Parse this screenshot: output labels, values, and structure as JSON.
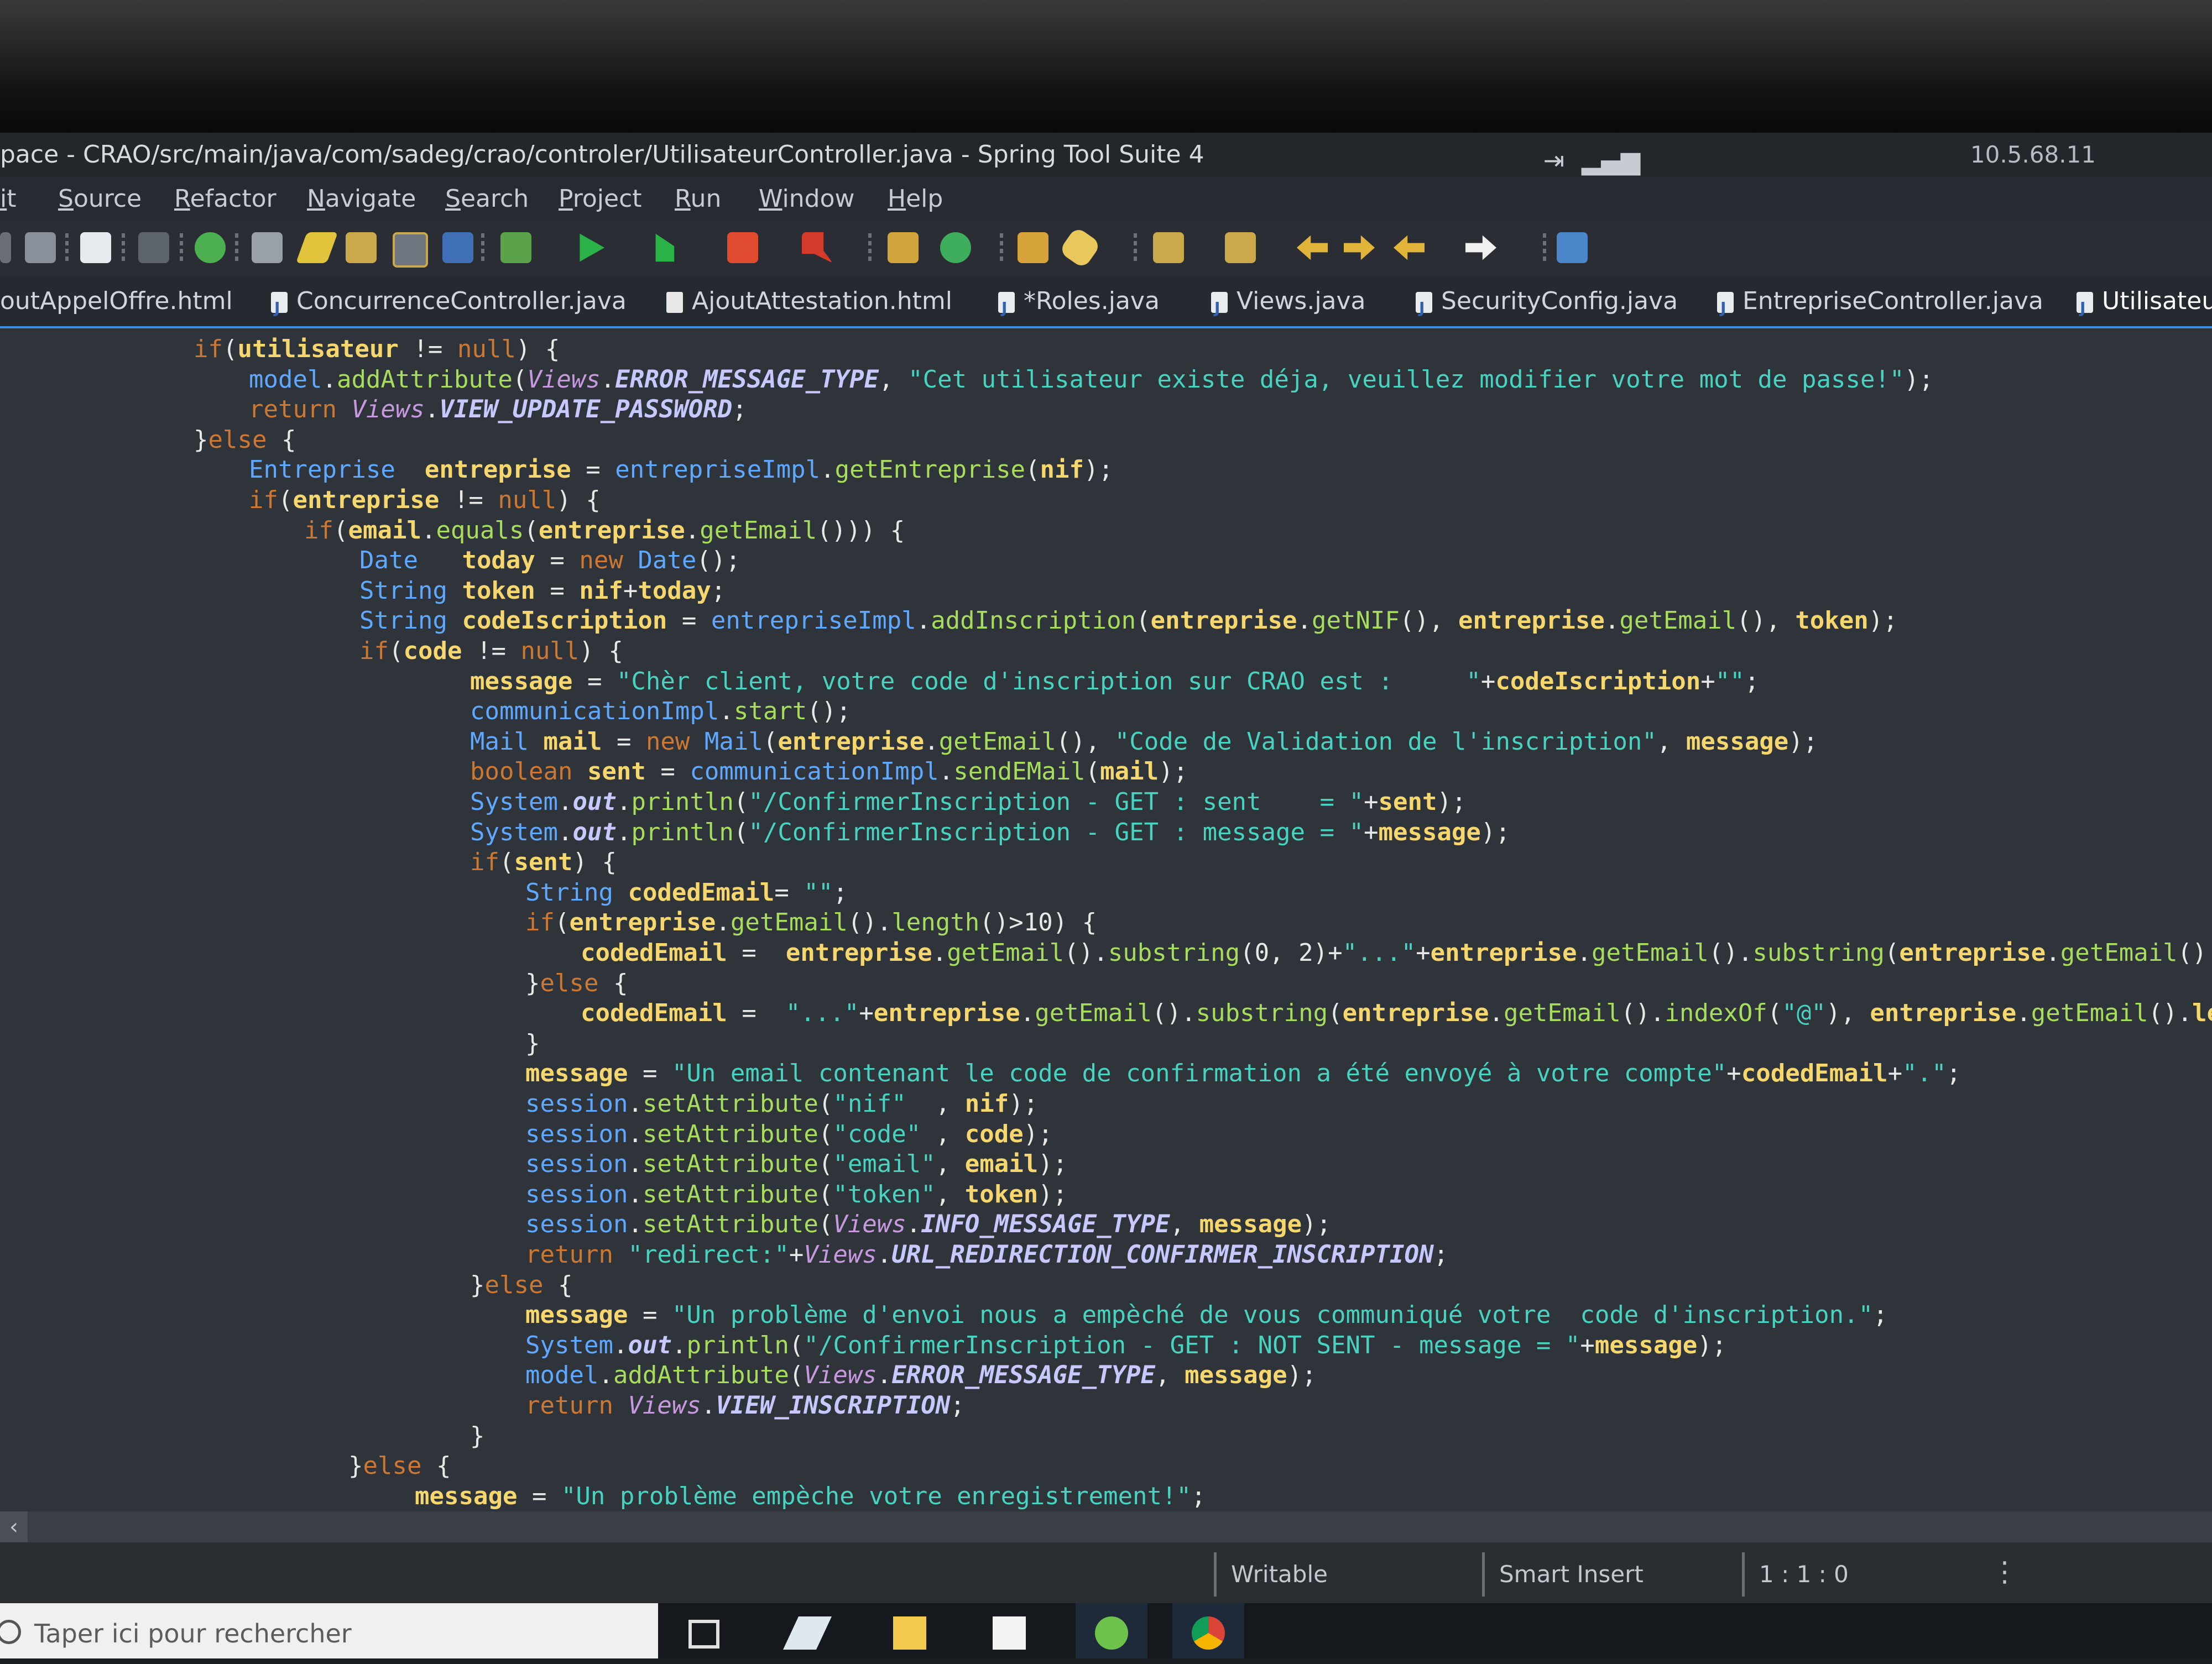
{
  "window": {
    "title": "pace - CRAO/src/main/java/com/sadeg/crao/controler/UtilisateurController.java - Spring Tool Suite 4",
    "ip": "10.5.68.11"
  },
  "menu": [
    "it",
    "Source",
    "Refactor",
    "Navigate",
    "Search",
    "Project",
    "Run",
    "Window",
    "Help"
  ],
  "tabs": [
    {
      "label": "outAppelOffre.html",
      "icon": "html-file-icon"
    },
    {
      "label": "ConcurrenceController.java",
      "icon": "java-file-icon"
    },
    {
      "label": "AjoutAttestation.html",
      "icon": "html-file-icon"
    },
    {
      "label": "*Roles.java",
      "icon": "java-file-icon"
    },
    {
      "label": "Views.java",
      "icon": "java-file-icon"
    },
    {
      "label": "SecurityConfig.java",
      "icon": "java-file-icon"
    },
    {
      "label": "EntrepriseController.java",
      "icon": "java-file-icon"
    },
    {
      "label": "Utilisateu",
      "icon": "java-file-icon",
      "active": true
    }
  ],
  "code_lines": [
    "if(utilisateur != null) {",
    "model.addAttribute(Views.ERROR_MESSAGE_TYPE, \"Cet utilisateur existe déja, veuillez modifier votre mot de passe!\");",
    "return Views.VIEW_UPDATE_PASSWORD;",
    "}else {",
    "Entreprise  entreprise = entrepriseImpl.getEntreprise(nif);",
    "if(entreprise != null) {",
    "if(email.equals(entreprise.getEmail())) {",
    "Date   today = new Date();",
    "String token = nif+today;",
    "String codeIscription = entrepriseImpl.addInscription(entreprise.getNIF(), entreprise.getEmail(), token);",
    "if(code != null) {",
    "message = \"Chèr client, votre code d'inscription sur CRAO est :     \"+codeIscription+\"\";",
    "communicationImpl.start();",
    "Mail mail = new Mail(entreprise.getEmail(), \"Code de Validation de l'inscription\", message);",
    "boolean sent = communicationImpl.sendEMail(mail);",
    "System.out.println(\"/ConfirmerInscription - GET : sent    = \"+sent);",
    "System.out.println(\"/ConfirmerInscription - GET : message = \"+message);",
    "if(sent) {",
    "String codedEmail= \"\";",
    "if(entreprise.getEmail().length()>10) {",
    "codedEmail =  entreprise.getEmail().substring(0, 2)+\"...\"+entreprise.getEmail().substring(entreprise.getEmail().inde",
    "}else {",
    "codedEmail =  \"...\"+entreprise.getEmail().substring(entreprise.getEmail().indexOf(\"@\"), entreprise.getEmail().length",
    "}",
    "message = \"Un email contenant le code de confirmation a été envoyé à votre compte\"+codedEmail+\".\";",
    "session.setAttribute(\"nif\"  , nif);",
    "session.setAttribute(\"code\" , code);",
    "session.setAttribute(\"email\", email);",
    "session.setAttribute(\"token\", token);",
    "session.setAttribute(Views.INFO_MESSAGE_TYPE, message);",
    "return \"redirect:\"+Views.URL_REDIRECTION_CONFIRMER_INSCRIPTION;",
    "}else {",
    "message = \"Un problème d'envoi nous a empèché de vous communiqué votre  code d'inscription.\";",
    "System.out.println(\"/ConfirmerInscription - GET : NOT SENT - message = \"+message);",
    "model.addAttribute(Views.ERROR_MESSAGE_TYPE, message);",
    "return Views.VIEW_INSCRIPTION;",
    "}",
    "}else {",
    "message = \"Un problème empèche votre enregistrement!\";"
  ],
  "status": {
    "mode": "Writable",
    "insert": "Smart Insert",
    "position": "1 : 1 : 0"
  },
  "taskbar": {
    "search_placeholder": "Taper ici pour rechercher"
  }
}
